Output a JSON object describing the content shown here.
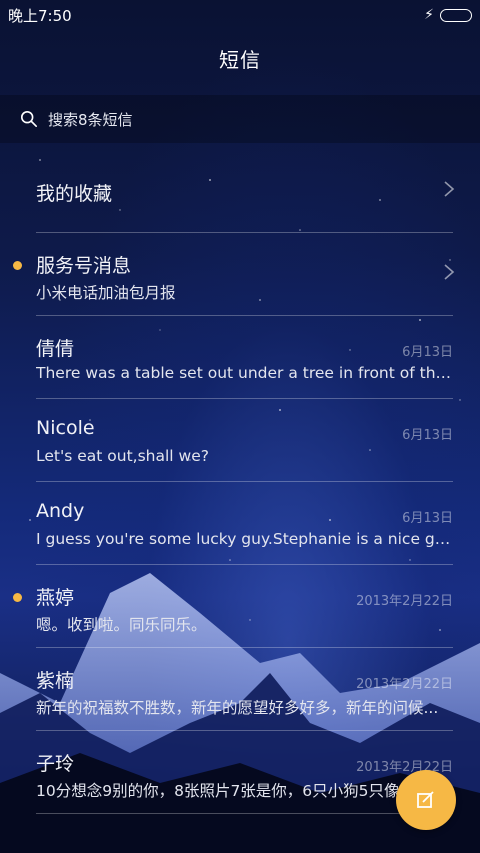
{
  "status_bar": {
    "time": "晚上7:50"
  },
  "header": {
    "title": "短信"
  },
  "search": {
    "label": "搜索8条短信"
  },
  "conversations": [
    {
      "name": "我的收藏",
      "preview": "",
      "date": "",
      "unread": false,
      "chevron": true
    },
    {
      "name": "服务号消息",
      "preview": "小米电话加油包月报",
      "date": "",
      "unread": true,
      "chevron": true
    },
    {
      "name": "倩倩",
      "preview": "There was a table set out under a tree in front of the ho...",
      "date": "6月13日",
      "unread": false,
      "chevron": false
    },
    {
      "name": "Nicole",
      "preview": "Let's eat out,shall we?",
      "date": "6月13日",
      "unread": false,
      "chevron": false
    },
    {
      "name": "Andy",
      "preview": "I guess you're some lucky guy.Stephanie is a nice girl.",
      "date": "6月13日",
      "unread": false,
      "chevron": false
    },
    {
      "name": "燕婷",
      "preview": "嗯。收到啦。同乐同乐。",
      "date": "2013年2月22日",
      "unread": true,
      "chevron": false
    },
    {
      "name": "紫楠",
      "preview": "新年的祝福数不胜数，新年的愿望好多好多，新年的问候...",
      "date": "2013年2月22日",
      "unread": false,
      "chevron": false
    },
    {
      "name": "子玲",
      "preview": "10分想念9别的你，8张照片7张是你，6只小狗5只像你",
      "date": "2013年2月22日",
      "unread": false,
      "chevron": false
    }
  ],
  "fab": {
    "icon": "compose-icon"
  },
  "colors": {
    "accent": "#f6b845"
  }
}
